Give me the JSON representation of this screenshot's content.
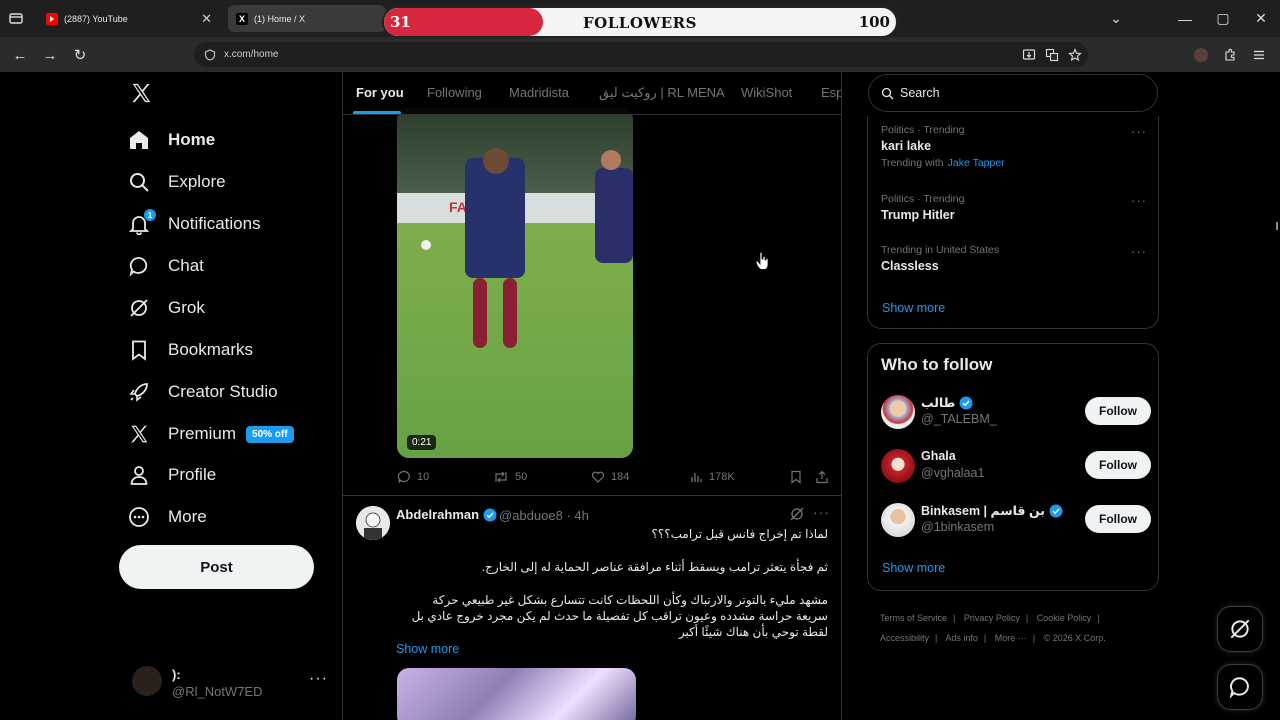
{
  "browser": {
    "tabs": [
      {
        "label": "(2887) YouTube",
        "favicon": "youtube-icon"
      },
      {
        "label": "(1) Home / X",
        "favicon": "x-logo-icon"
      }
    ],
    "url": "x.com/home"
  },
  "overlay": {
    "title": "FOLLOWERS",
    "current": "31",
    "goal": "100",
    "progress_fraction": 0.31,
    "fill_color": "#d7263d"
  },
  "sidebar": {
    "items": [
      {
        "label": "Home",
        "icon": "home-icon"
      },
      {
        "label": "Explore",
        "icon": "search-icon"
      },
      {
        "label": "Notifications",
        "icon": "bell-icon",
        "badge": "1"
      },
      {
        "label": "Chat",
        "icon": "chat-icon"
      },
      {
        "label": "Grok",
        "icon": "grok-icon"
      },
      {
        "label": "Bookmarks",
        "icon": "bookmark-icon"
      },
      {
        "label": "Creator Studio",
        "icon": "rocket-icon"
      },
      {
        "label": "Premium",
        "icon": "x-icon",
        "badge": "50% off"
      },
      {
        "label": "Profile",
        "icon": "person-icon"
      },
      {
        "label": "More",
        "icon": "more-circle-icon"
      }
    ],
    "post_label": "Post",
    "account": {
      "name": "):",
      "handle": "@Rl_NotW7ED"
    }
  },
  "feed": {
    "tabs": [
      "For you",
      "Following",
      "Madridista",
      "روكيت ليق | RL MENA",
      "WikiShot",
      "Esp"
    ],
    "video_duration": "0:21",
    "video_ad_text": "FAQ طيران",
    "actions": {
      "replies": "10",
      "reposts": "50",
      "likes": "184",
      "views": "178K"
    },
    "tweet2": {
      "name": "Abdelrahman",
      "handle": "@abduoe8",
      "time": "4h",
      "line1": "لماذا تم إخراج فانس قبل ترامب؟؟؟",
      "line2": "ثم فجأة يتعثر ترامب ويسقط أثناء مرافقة عناصر الحماية له إلى الخارج.",
      "line3": "مشهد مليء بالتوتر والارتباك وكأن اللحظات كانت تتسارع بشكل غير طبيعي حركة",
      "line4": "سريعة حراسة مشدده  وعيون تراقب كل تفصيلة ما حدث لم يكن مجرد خروج عادي بل",
      "line5": "لقطة توحي بأن هناك شيئًا أكبر",
      "show_more": "Show more"
    }
  },
  "rightcol": {
    "search_placeholder": "Search",
    "trends": [
      {
        "category": "Politics · Trending",
        "title": "kari lake",
        "with_label": "Trending with",
        "with_name": "Jake Tapper"
      },
      {
        "category": "Politics · Trending",
        "title": "Trump Hitler"
      },
      {
        "category": "Trending in United States",
        "title": "Classless"
      }
    ],
    "trends_show_more": "Show more",
    "who_to_follow": {
      "title": "Who to follow",
      "users": [
        {
          "name": "طالب",
          "handle": "@_TALEBM_",
          "verified": true
        },
        {
          "name": "Ghala",
          "handle": "@vghalaa1",
          "verified": false
        },
        {
          "name": "Binkasem | بن قاسم",
          "handle": "@1binkasem",
          "verified": true
        }
      ],
      "follow_label": "Follow",
      "show_more": "Show more"
    },
    "footer": {
      "links": [
        "Terms of Service",
        "Privacy Policy",
        "Cookie Policy",
        "Accessibility",
        "Ads info",
        "More ···"
      ],
      "copyright": "© 2026 X Corp."
    }
  },
  "colors": {
    "accent": "#1d9bf0",
    "bg": "#000000",
    "border": "#2f3336",
    "muted": "#71767b"
  }
}
